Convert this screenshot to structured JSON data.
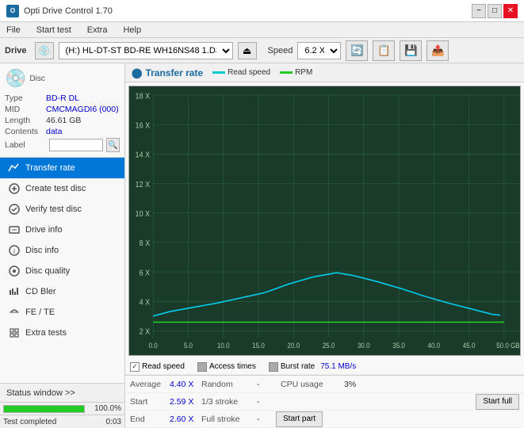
{
  "title_bar": {
    "title": "Opti Drive Control 1.70",
    "min": "−",
    "max": "□",
    "close": "✕"
  },
  "menu": {
    "items": [
      "File",
      "Start test",
      "Extra",
      "Help"
    ]
  },
  "drive_toolbar": {
    "drive_label": "Drive",
    "drive_value": "(H:)  HL-DT-ST BD-RE  WH16NS48 1.D3",
    "speed_label": "Speed",
    "speed_value": "6.2 X"
  },
  "disc": {
    "header_icon": "💿",
    "type_label": "Type",
    "type_value": "BD-R DL",
    "mid_label": "MID",
    "mid_value": "CMCMAGDI6 (000)",
    "length_label": "Length",
    "length_value": "46.61 GB",
    "contents_label": "Contents",
    "contents_value": "data",
    "label_label": "Label",
    "label_value": ""
  },
  "nav": {
    "items": [
      {
        "id": "transfer-rate",
        "label": "Transfer rate",
        "active": true
      },
      {
        "id": "create-test-disc",
        "label": "Create test disc",
        "active": false
      },
      {
        "id": "verify-test-disc",
        "label": "Verify test disc",
        "active": false
      },
      {
        "id": "drive-info",
        "label": "Drive info",
        "active": false
      },
      {
        "id": "disc-info",
        "label": "Disc info",
        "active": false
      },
      {
        "id": "disc-quality",
        "label": "Disc quality",
        "active": false
      },
      {
        "id": "cd-bler",
        "label": "CD Bler",
        "active": false
      },
      {
        "id": "fe-te",
        "label": "FE / TE",
        "active": false
      },
      {
        "id": "extra-tests",
        "label": "Extra tests",
        "active": false
      }
    ]
  },
  "status_window": {
    "label": "Status window >>",
    "progress_pct": "100.0%",
    "status_text": "Test completed",
    "time": "0:03"
  },
  "chart": {
    "title": "Transfer rate",
    "legend": {
      "read_label": "Read speed",
      "rpm_label": "RPM"
    },
    "y_labels": [
      "18 X",
      "16 X",
      "14 X",
      "12 X",
      "10 X",
      "8 X",
      "6 X",
      "4 X",
      "2 X"
    ],
    "x_labels": [
      "0.0",
      "5.0",
      "10.0",
      "15.0",
      "20.0",
      "25.0",
      "30.0",
      "35.0",
      "40.0",
      "45.0",
      "50.0 GB"
    ]
  },
  "checkboxes": {
    "read_speed_label": "Read speed",
    "access_times_label": "Access times",
    "burst_rate_label": "Burst rate",
    "burst_rate_value": "75.1 MB/s"
  },
  "stats": {
    "rows": [
      {
        "key1": "Average",
        "val1": "4.40 X",
        "key2": "Random",
        "val2": "-",
        "key3": "CPU usage",
        "val3": "3%"
      },
      {
        "key1": "Start",
        "val1": "2.59 X",
        "key2": "1/3 stroke",
        "val2": "-",
        "key3": "",
        "val3": "",
        "btn": "Start full"
      },
      {
        "key1": "End",
        "val1": "2.60 X",
        "key2": "Full stroke",
        "val2": "-",
        "key3": "",
        "val3": "",
        "btn": "Start part"
      }
    ]
  }
}
